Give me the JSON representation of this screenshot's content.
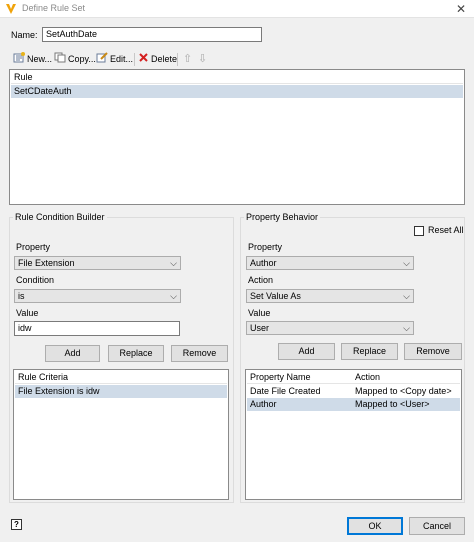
{
  "window": {
    "title": "Define Rule Set",
    "close_glyph": "✕",
    "logo_letter": "V"
  },
  "name_field": {
    "label": "Name:",
    "value": "SetAuthDate"
  },
  "toolbar": {
    "new_label": "New...",
    "copy_label": "Copy...",
    "edit_label": "Edit...",
    "delete_label": "Delete",
    "up_glyph": "⇧",
    "down_glyph": "⇩"
  },
  "rules": {
    "header": "Rule",
    "items": [
      {
        "label": "SetCDateAuth",
        "selected": true
      }
    ]
  },
  "rule_builder": {
    "title": "Rule Condition Builder",
    "property_label": "Property",
    "property_value": "File Extension",
    "condition_label": "Condition",
    "condition_value": "is",
    "value_label": "Value",
    "value_text": "idw",
    "add_label": "Add",
    "replace_label": "Replace",
    "remove_label": "Remove",
    "criteria_header": "Rule Criteria",
    "criteria": [
      {
        "label": "File Extension is idw",
        "selected": true
      }
    ]
  },
  "property_behavior": {
    "title": "Property Behavior",
    "reset_all_label": "Reset All",
    "reset_all_checked": false,
    "property_label": "Property",
    "property_value": "Author",
    "action_label": "Action",
    "action_value": "Set Value As",
    "value_label": "Value",
    "value_value": "User",
    "add_label": "Add",
    "replace_label": "Replace",
    "remove_label": "Remove",
    "columns": [
      "Property Name",
      "Action"
    ],
    "rows": [
      {
        "name": "Date File Created",
        "action": "Mapped to <Copy date>",
        "selected": false
      },
      {
        "name": "Author",
        "action": "Mapped to <User>",
        "selected": true
      }
    ]
  },
  "footer": {
    "help_glyph": "?",
    "ok_label": "OK",
    "cancel_label": "Cancel"
  },
  "colors": {
    "selection": "#cfdbe8",
    "logo": "#f0a30a",
    "delete_icon": "#d42020"
  }
}
